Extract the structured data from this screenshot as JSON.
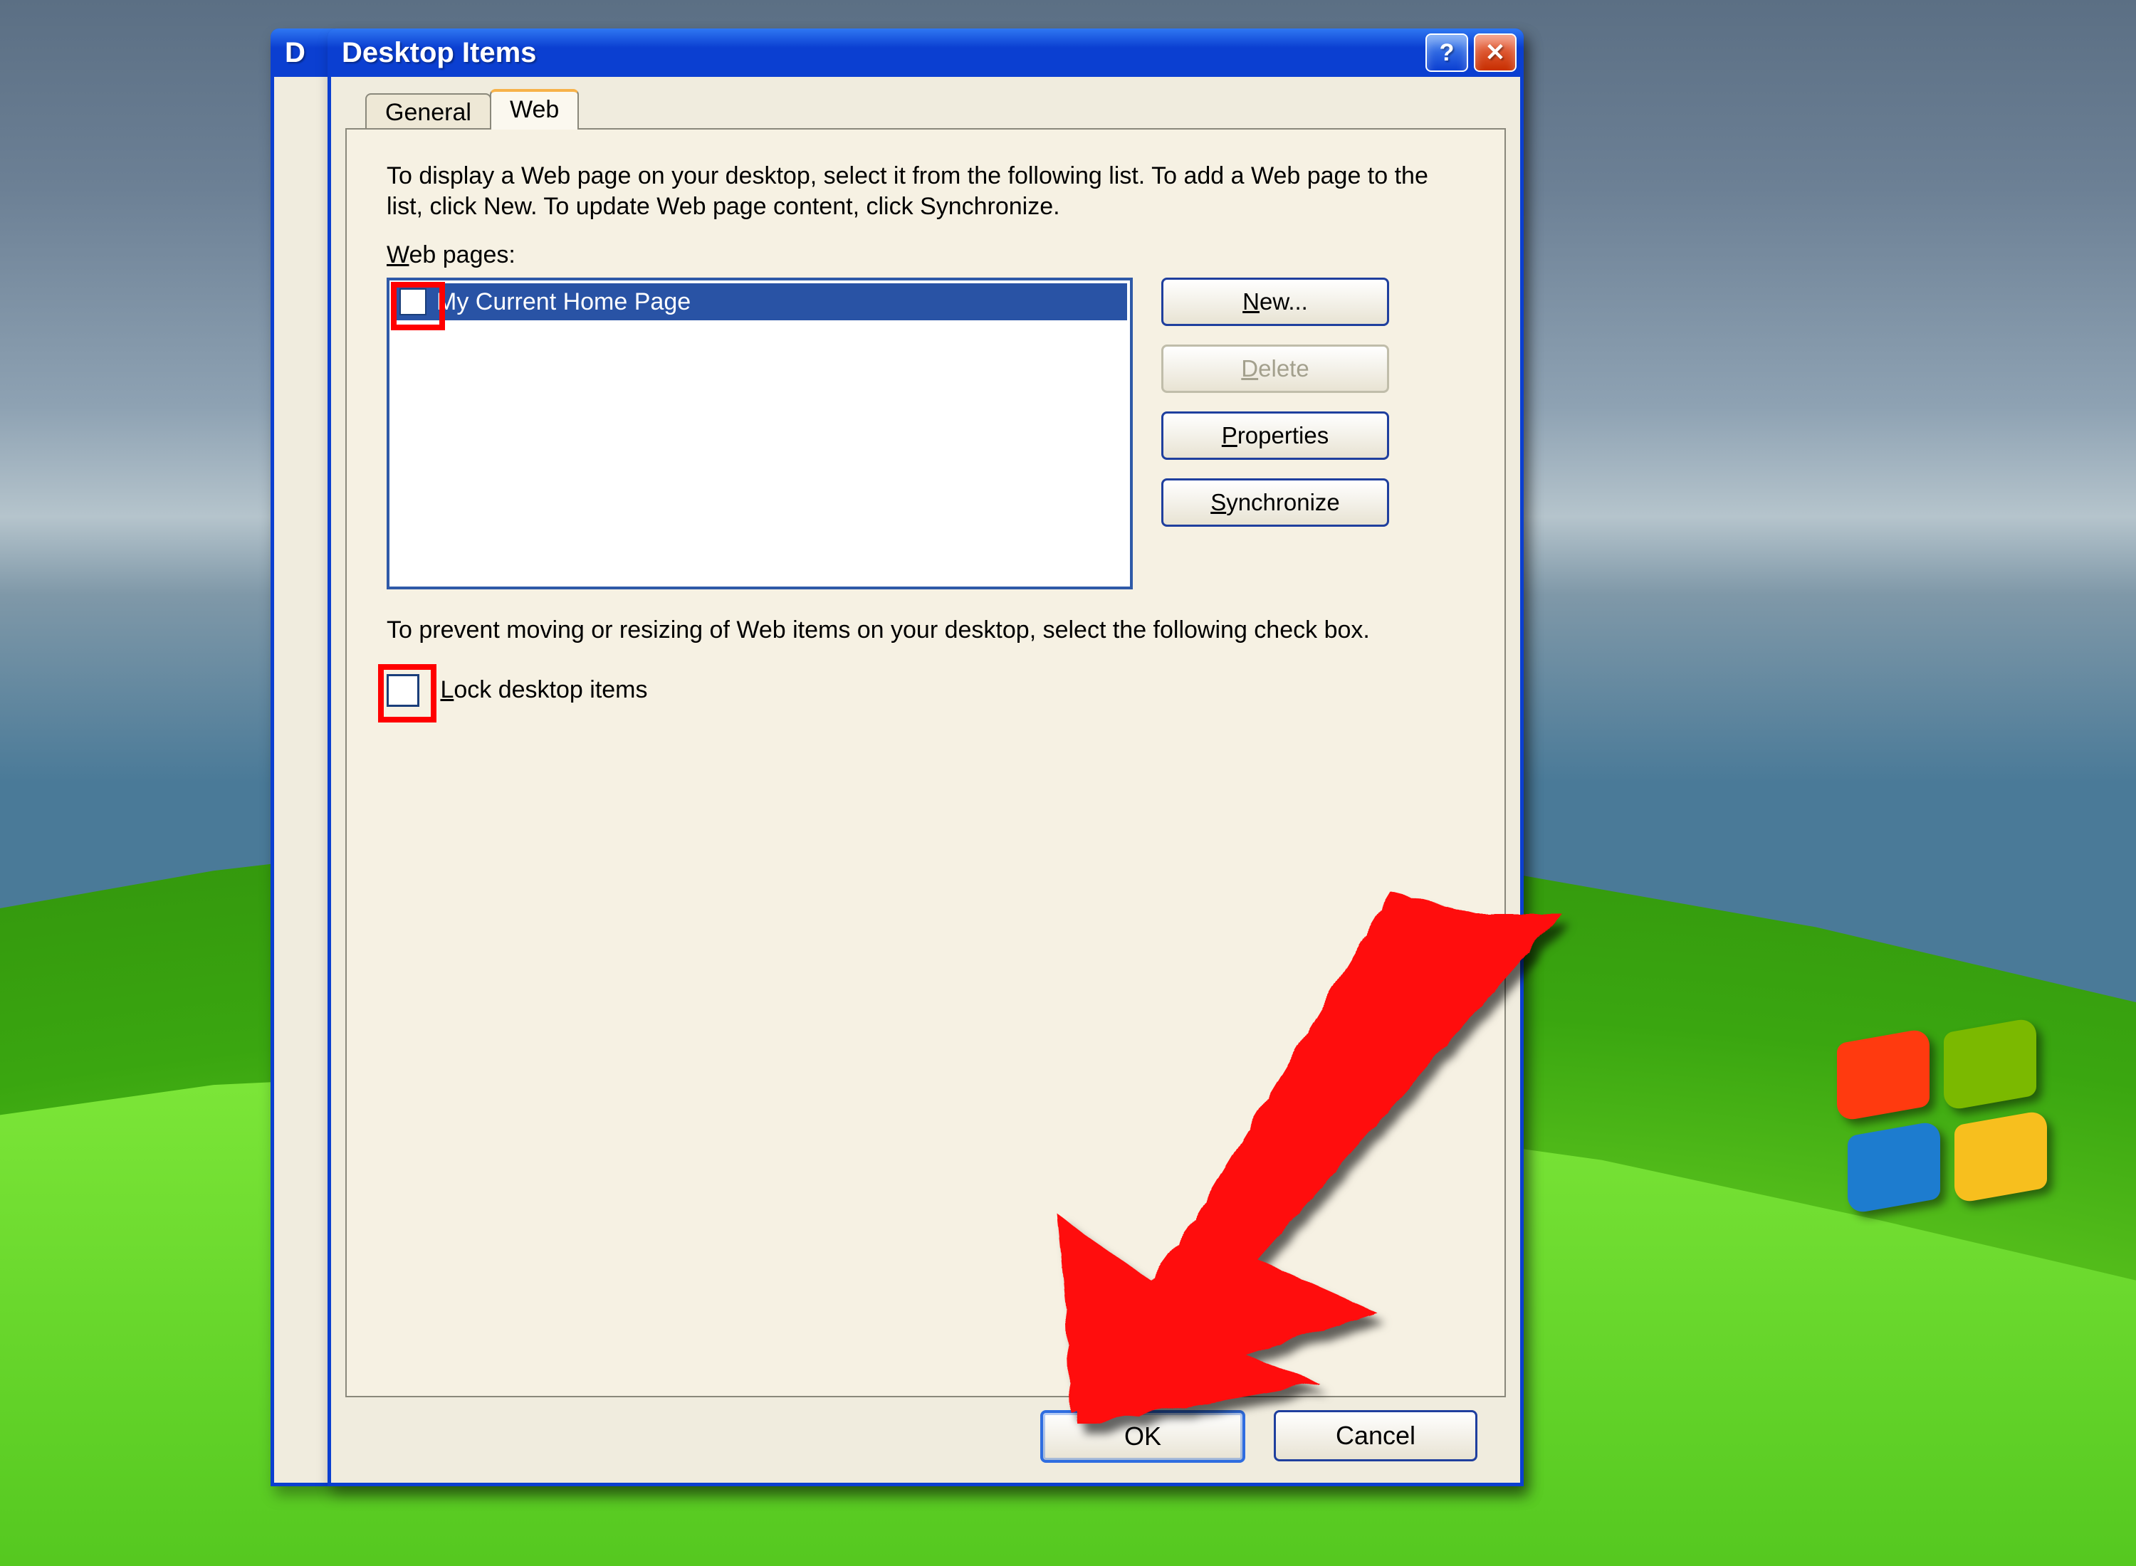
{
  "background_dialog": {
    "title_initial": "D"
  },
  "dialog": {
    "title": "Desktop Items",
    "help_tooltip": "?",
    "close_tooltip": "X"
  },
  "tabs": {
    "general": "General",
    "web": "Web"
  },
  "web_tab": {
    "description": "To display a Web page on your desktop, select it from the following list. To add a Web page to the list, click New.  To update Web page content, click Synchronize.",
    "list_label": "Web pages:",
    "list_label_underline": "W",
    "items": [
      {
        "label": "My Current Home Page",
        "checked": false,
        "selected": true
      }
    ],
    "buttons": {
      "new": "New...",
      "delete": "Delete",
      "properties": "Properties",
      "synchronize": "Synchronize"
    },
    "lock_description": "To prevent moving or resizing of Web items on your desktop, select the following check box.",
    "lock_label": "Lock desktop items",
    "lock_label_visible": "ock desktop items",
    "lock_checked": false
  },
  "dialog_actions": {
    "ok": "OK",
    "cancel": "Cancel"
  },
  "annotations": {
    "highlight_webitem_checkbox": true,
    "highlight_lock_checkbox": true,
    "arrow_to_ok": true
  },
  "colors": {
    "accent": "#0b3fd1",
    "highlight": "#ff0000",
    "tab_active_top": "#f7b24a"
  }
}
